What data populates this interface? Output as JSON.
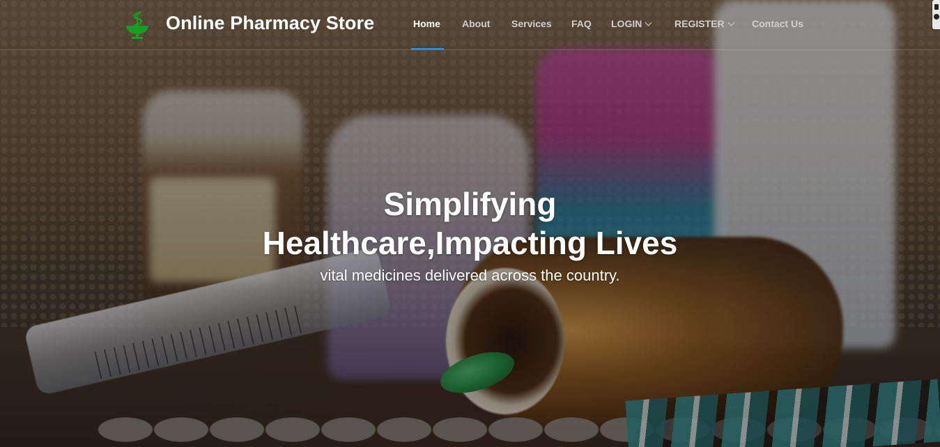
{
  "brand": {
    "name": "Online Pharmacy Store",
    "logo_icon": "caduceus-bowl-icon",
    "logo_color": "#1a9b22"
  },
  "nav": {
    "items": [
      {
        "label": "Home",
        "active": true
      },
      {
        "label": "About"
      },
      {
        "label": "Services"
      },
      {
        "label": "FAQ"
      },
      {
        "label": "LOGIN",
        "dropdown": true
      },
      {
        "label": "REGISTER",
        "dropdown": true
      },
      {
        "label": "Contact Us"
      }
    ],
    "active_color": "#2a8fd6"
  },
  "hero": {
    "title_line1": "Simplifying",
    "title_line2": "Healthcare,Impacting Lives",
    "subtitle": "vital medicines delivered across the country.",
    "background": "pharmacy-medicines-photo"
  }
}
